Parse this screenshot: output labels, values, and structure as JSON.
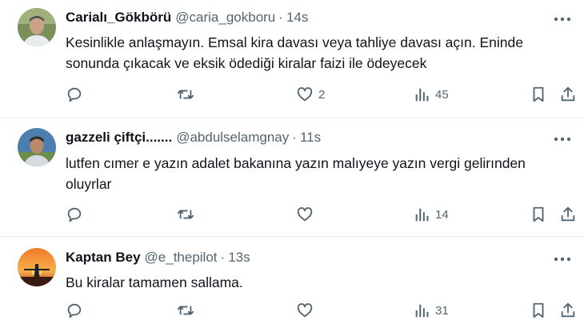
{
  "tweets": [
    {
      "name": "Carialı_Gökbörü",
      "handle": "@caria_gokboru",
      "dot": "·",
      "time": "14s",
      "text": "Kesinlikle anlaşmayın. Emsal kira davası veya tahliye davası açın. Eninde sonunda çıkacak ve eksik ödediği kiralar faizi ile ödeyecek",
      "likes": "2",
      "views": "45"
    },
    {
      "name": "gazzeli çiftçi.......",
      "handle": "@abdulselamgnay",
      "dot": "·",
      "time": "11s",
      "text": "lutfen cımer e yazın adalet bakanına yazın malıyeye yazın vergi gelirınden oluyrlar",
      "likes": "",
      "views": "14"
    },
    {
      "name": "Kaptan Bey",
      "handle": "@e_thepilot",
      "dot": "·",
      "time": "13s",
      "text": "Bu kiralar tamamen sallama.",
      "likes": "",
      "views": "31"
    }
  ],
  "colors": {
    "text": "#0f1419",
    "secondary": "#536471",
    "divider": "#e6ecf0"
  },
  "icons": [
    "more-icon",
    "reply-icon",
    "retweet-icon",
    "like-icon",
    "views-icon",
    "bookmark-icon",
    "share-icon"
  ]
}
